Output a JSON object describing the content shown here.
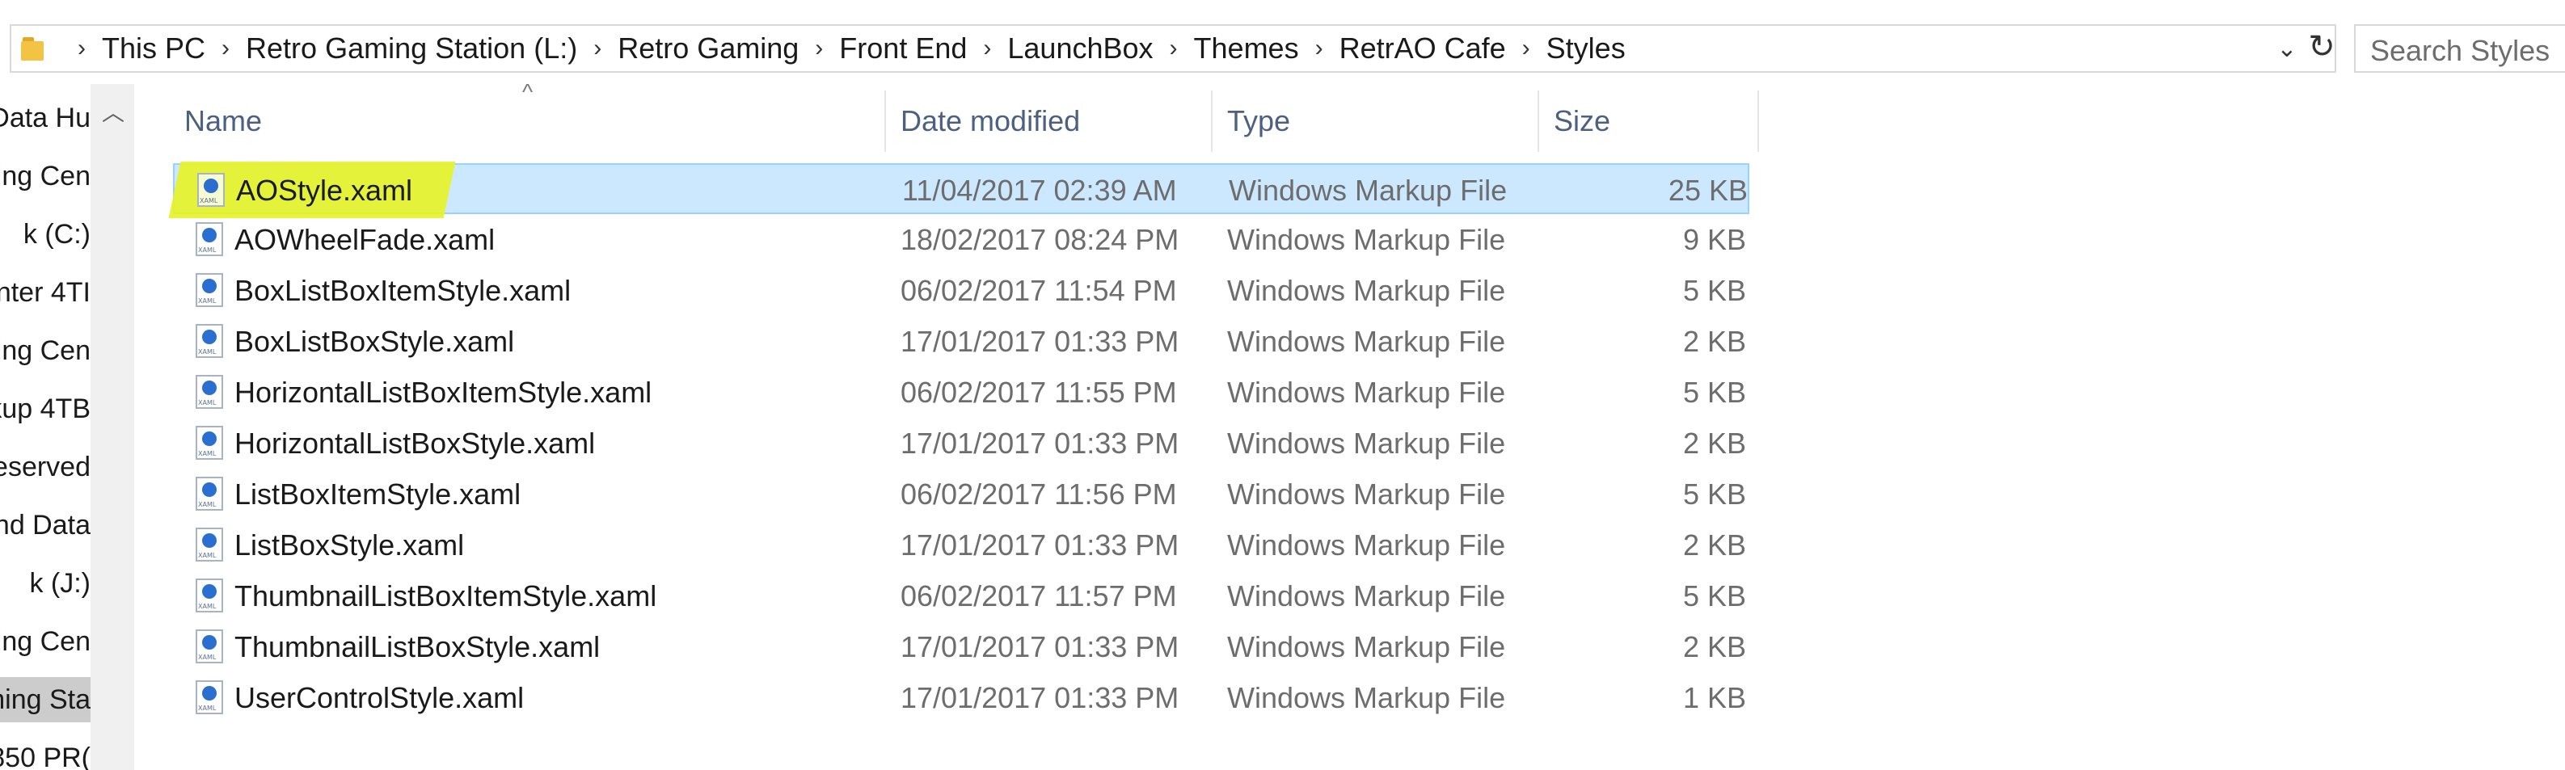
{
  "address_bar": {
    "breadcrumbs": [
      "This PC",
      "Retro Gaming Station (L:)",
      "Retro Gaming",
      "Front End",
      "LaunchBox",
      "Themes",
      "RetrAO Cafe",
      "Styles"
    ],
    "search_placeholder": "Search Styles"
  },
  "nav_pane": {
    "items": [
      "Data Hu",
      "ing Cen",
      "k (C:)",
      "nter 4TI",
      "ing Cen",
      "kup 4TB",
      "eserved",
      "nd Data",
      "k (J:)",
      "ing Cen",
      "ming Sta",
      "850 PR("
    ],
    "selected_index": 10
  },
  "columns": {
    "name": "Name",
    "date": "Date modified",
    "type": "Type",
    "size": "Size"
  },
  "files": [
    {
      "name": "AOStyle.xaml",
      "date": "11/04/2017 02:39 AM",
      "type": "Windows Markup File",
      "size": "25 KB"
    },
    {
      "name": "AOWheelFade.xaml",
      "date": "18/02/2017 08:24 PM",
      "type": "Windows Markup File",
      "size": "9 KB"
    },
    {
      "name": "BoxListBoxItemStyle.xaml",
      "date": "06/02/2017 11:54 PM",
      "type": "Windows Markup File",
      "size": "5 KB"
    },
    {
      "name": "BoxListBoxStyle.xaml",
      "date": "17/01/2017 01:33 PM",
      "type": "Windows Markup File",
      "size": "2 KB"
    },
    {
      "name": "HorizontalListBoxItemStyle.xaml",
      "date": "06/02/2017 11:55 PM",
      "type": "Windows Markup File",
      "size": "5 KB"
    },
    {
      "name": "HorizontalListBoxStyle.xaml",
      "date": "17/01/2017 01:33 PM",
      "type": "Windows Markup File",
      "size": "2 KB"
    },
    {
      "name": "ListBoxItemStyle.xaml",
      "date": "06/02/2017 11:56 PM",
      "type": "Windows Markup File",
      "size": "5 KB"
    },
    {
      "name": "ListBoxStyle.xaml",
      "date": "17/01/2017 01:33 PM",
      "type": "Windows Markup File",
      "size": "2 KB"
    },
    {
      "name": "ThumbnailListBoxItemStyle.xaml",
      "date": "06/02/2017 11:57 PM",
      "type": "Windows Markup File",
      "size": "5 KB"
    },
    {
      "name": "ThumbnailListBoxStyle.xaml",
      "date": "17/01/2017 01:33 PM",
      "type": "Windows Markup File",
      "size": "2 KB"
    },
    {
      "name": "UserControlStyle.xaml",
      "date": "17/01/2017 01:33 PM",
      "type": "Windows Markup File",
      "size": "1 KB"
    }
  ],
  "selected_file_index": 0,
  "colors": {
    "selection": "#cce8ff",
    "highlighter": "#e6f228"
  }
}
